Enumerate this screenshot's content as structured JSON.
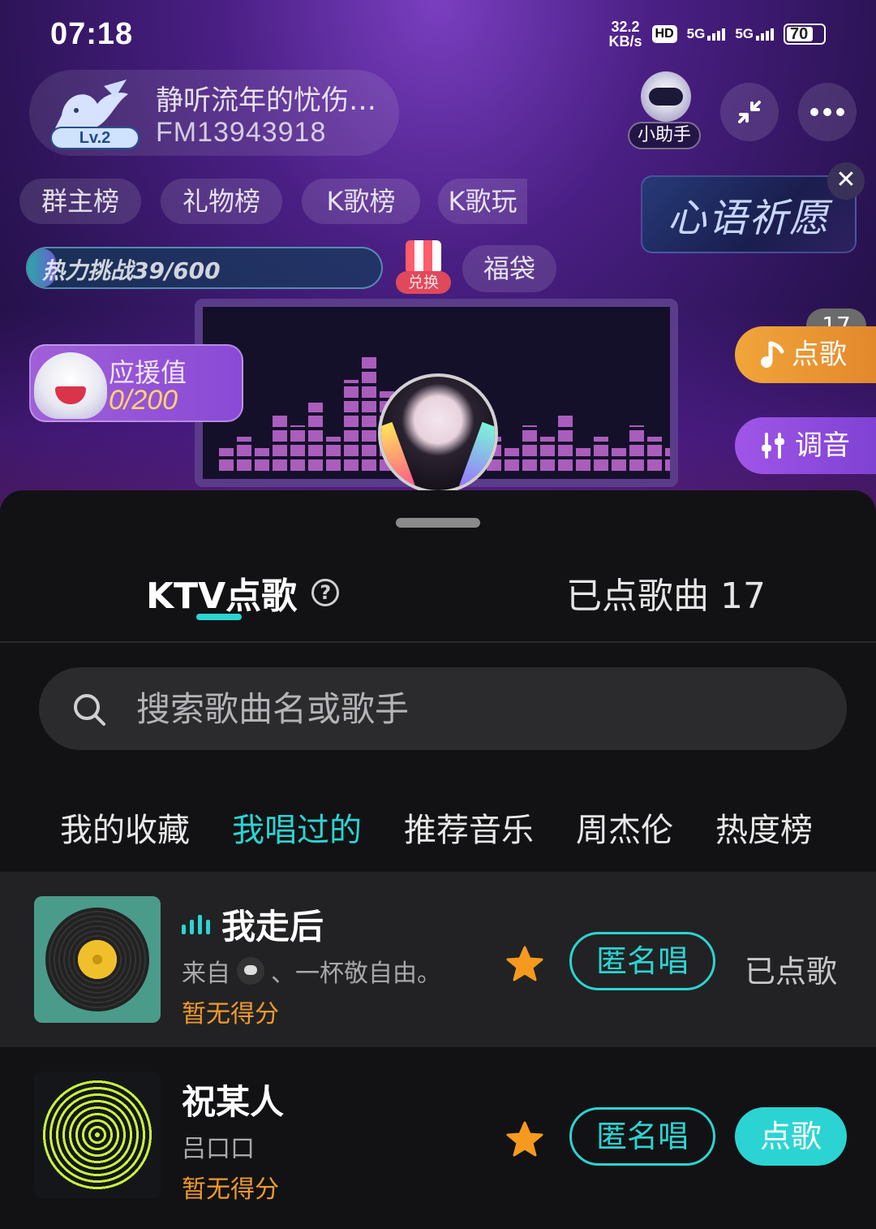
{
  "status_bar": {
    "time": "07:18",
    "net_speed_value": "32.2",
    "net_speed_unit": "KB/s",
    "hd_label": "HD",
    "signal_1_label": "5G",
    "signal_2_label": "5G",
    "battery": "70",
    "battery_level": 0.7
  },
  "room": {
    "name": "静听流年的忧伤…",
    "id": "FM13943918",
    "level": "Lv.2",
    "assistant_label": "小助手"
  },
  "rank_chips": [
    "群主榜",
    "礼物榜",
    "K歌榜",
    "K歌玩"
  ],
  "wish_banner": "心语祈愿",
  "heat_challenge": {
    "label": "热力挑战39/600",
    "progress": 0.065
  },
  "exchange_label": "兑换",
  "lucky_bag_label": "福袋",
  "support": {
    "title": "应援值",
    "value": "0/200"
  },
  "side_buttons": {
    "song_label": "点歌",
    "song_count": "17",
    "tune_label": "调音"
  },
  "sheet": {
    "tab_ktv": "KTV点歌",
    "tab_ordered": "已点歌曲 17",
    "search_placeholder": "搜索歌曲名或歌手",
    "categories": [
      "我的收藏",
      "我唱过的",
      "推荐音乐",
      "周杰伦",
      "热度榜"
    ],
    "active_category": "我唱过的",
    "songs": [
      {
        "title": "我走后",
        "from_prefix": "来自",
        "from_user": "、一杯敬自由。",
        "score": "暂无得分",
        "anon_label": "匿名唱",
        "action_label": "已点歌",
        "playing": true,
        "favorited": true
      },
      {
        "title": "祝某人",
        "artist": "吕口口",
        "score": "暂无得分",
        "anon_label": "匿名唱",
        "action_label": "点歌",
        "playing": false,
        "favorited": true
      }
    ]
  },
  "colors": {
    "accent": "#2bd4d2",
    "score": "#ef9a2c",
    "star": "#f59a1e"
  }
}
